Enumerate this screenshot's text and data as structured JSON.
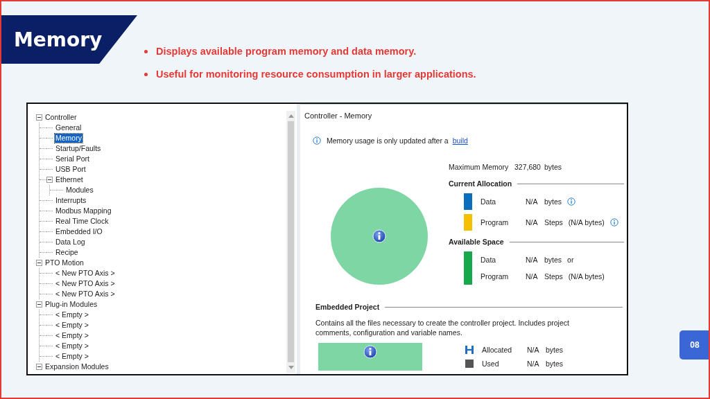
{
  "slide": {
    "title": "Memory",
    "bullets": [
      "Displays available program memory and data memory.",
      "Useful for monitoring resource consumption in larger applications."
    ],
    "page_number": "08"
  },
  "tree": [
    {
      "label": "Controller",
      "expanded": true,
      "selected": false,
      "children": [
        {
          "label": "General",
          "selected": false
        },
        {
          "label": "Memory",
          "selected": true
        },
        {
          "label": "Startup/Faults",
          "selected": false
        },
        {
          "label": "Serial Port",
          "selected": false
        },
        {
          "label": "USB Port",
          "selected": false
        },
        {
          "label": "Ethernet",
          "expanded": true,
          "selected": false,
          "children": [
            {
              "label": "Modules",
              "selected": false
            }
          ]
        },
        {
          "label": "Interrupts",
          "selected": false
        },
        {
          "label": "Modbus Mapping",
          "selected": false
        },
        {
          "label": "Real Time Clock",
          "selected": false
        },
        {
          "label": "Embedded I/O",
          "selected": false
        },
        {
          "label": "Data Log",
          "selected": false
        },
        {
          "label": "Recipe",
          "selected": false
        }
      ]
    },
    {
      "label": "PTO Motion",
      "expanded": true,
      "selected": false,
      "children": [
        {
          "label": "< New PTO Axis >",
          "selected": false
        },
        {
          "label": "< New PTO Axis >",
          "selected": false
        },
        {
          "label": "< New PTO Axis >",
          "selected": false
        }
      ]
    },
    {
      "label": "Plug-in Modules",
      "expanded": true,
      "selected": false,
      "children": [
        {
          "label": "< Empty >",
          "selected": false
        },
        {
          "label": "< Empty >",
          "selected": false
        },
        {
          "label": "< Empty >",
          "selected": false
        },
        {
          "label": "< Empty >",
          "selected": false
        },
        {
          "label": "< Empty >",
          "selected": false
        }
      ]
    },
    {
      "label": "Expansion Modules",
      "expanded": true,
      "selected": false
    }
  ],
  "panel": {
    "title": "Controller - Memory",
    "notice": {
      "text": "Memory usage is only updated after a",
      "link": "build"
    },
    "maximum": {
      "label": "Maximum Memory",
      "value": "327,680",
      "unit": "bytes"
    },
    "sections": [
      {
        "heading": "Current Allocation",
        "groups": [
          {
            "color": "#0a6ebd",
            "rows": [
              {
                "label": "Data",
                "value": "N/A",
                "unit": "bytes",
                "info": true
              }
            ]
          },
          {
            "color": "#f5c000",
            "rows": [
              {
                "label": "Program",
                "value": "N/A",
                "unit": "Steps",
                "extra": "(N/A bytes)",
                "info": true
              }
            ]
          }
        ]
      },
      {
        "heading": "Available Space",
        "groups": [
          {
            "color": "#16a84a",
            "rows": [
              {
                "label": "Data",
                "value": "N/A",
                "unit": "bytes",
                "extra": "or",
                "info": false
              },
              {
                "label": "Program",
                "value": "N/A",
                "unit": "Steps",
                "extra": "(N/A bytes)",
                "info": false
              }
            ]
          }
        ]
      }
    ],
    "embedded": {
      "heading": "Embedded Project",
      "description": "Contains all the files necessary to create the controller project. Includes project comments, configuration and variable names.",
      "rows": [
        {
          "kind": "allocated",
          "label": "Allocated",
          "value": "N/A",
          "unit": "bytes"
        },
        {
          "kind": "used",
          "label": "Used",
          "value": "N/A",
          "unit": "bytes"
        }
      ]
    }
  }
}
